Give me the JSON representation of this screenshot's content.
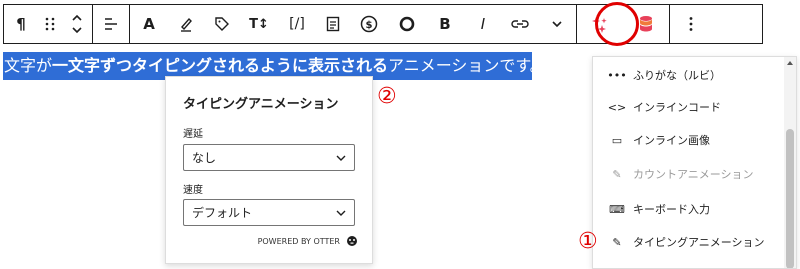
{
  "toolbar": {
    "buttons": [
      {
        "name": "paragraph",
        "glyph": "¶"
      },
      {
        "name": "drag",
        "glyph": "⠿"
      },
      {
        "name": "move",
        "glyph": ""
      },
      {
        "name": "align",
        "glyph": ""
      },
      {
        "name": "text-color",
        "glyph": "A"
      },
      {
        "name": "highlight",
        "glyph": ""
      },
      {
        "name": "tag",
        "glyph": ""
      },
      {
        "name": "font-size",
        "glyph": "T↕"
      },
      {
        "name": "code",
        "glyph": "[/]"
      },
      {
        "name": "doc",
        "glyph": ""
      },
      {
        "name": "dollar",
        "glyph": "$"
      },
      {
        "name": "circle",
        "glyph": "O"
      },
      {
        "name": "bold",
        "glyph": "B"
      },
      {
        "name": "italic",
        "glyph": "I"
      },
      {
        "name": "link",
        "glyph": ""
      },
      {
        "name": "more-rich-text",
        "glyph": ""
      },
      {
        "name": "ai",
        "glyph": ""
      },
      {
        "name": "database",
        "glyph": ""
      },
      {
        "name": "options",
        "glyph": "⋮"
      }
    ],
    "accent": "#e00000"
  },
  "text_line": {
    "prefix": "文字が",
    "bold": "一文字ずつタイピングされるように表示される",
    "suffix": "アニメーションです。"
  },
  "popup": {
    "title": "タイピングアニメーション",
    "delay_label": "遅延",
    "delay_value": "なし",
    "speed_label": "速度",
    "speed_value": "デフォルト",
    "powered_by": "POWERED BY OTTER"
  },
  "annotations": {
    "one": "①",
    "two": "②"
  },
  "menu": {
    "items": [
      {
        "label": "ふりがな（ルビ）",
        "icon": "•••"
      },
      {
        "label": "インラインコード",
        "icon": "<>"
      },
      {
        "label": "インライン画像",
        "icon": "▭"
      },
      {
        "label": "カウントアニメーション",
        "icon": "✎"
      },
      {
        "label": "キーボード入力",
        "icon": "⌨"
      },
      {
        "label": "タイピングアニメーション",
        "icon": "✎"
      }
    ]
  }
}
